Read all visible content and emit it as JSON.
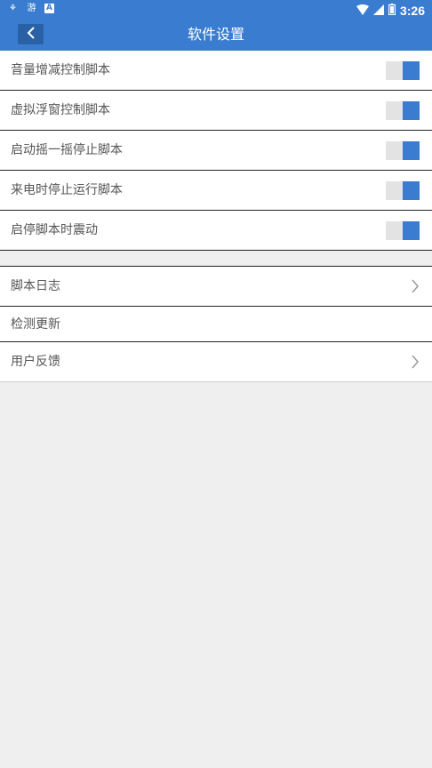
{
  "status_bar": {
    "left_icons": [
      "app-notification-icon",
      "game-notification-icon",
      "a-notification-icon"
    ],
    "left_texts": [
      "⚘",
      "游",
      "A"
    ],
    "time": "3:26",
    "right_icons": [
      "wifi-icon",
      "cell-signal-icon",
      "battery-icon"
    ]
  },
  "app_bar": {
    "title": "软件设置",
    "back_icon": "chevron-left-icon"
  },
  "settings": {
    "toggles": [
      {
        "label": "音量增减控制脚本",
        "on": true
      },
      {
        "label": "虚拟浮窗控制脚本",
        "on": true
      },
      {
        "label": "启动摇一摇停止脚本",
        "on": true
      },
      {
        "label": "来电时停止运行脚本",
        "on": true
      },
      {
        "label": "启停脚本时震动",
        "on": true
      }
    ],
    "links": [
      {
        "label": "脚本日志",
        "chevron": true
      },
      {
        "label": "检测更新",
        "chevron": false
      },
      {
        "label": "用户反馈",
        "chevron": true
      }
    ]
  },
  "colors": {
    "accent": "#3a7dd0",
    "toggle_track": "#e3e3e3",
    "background": "#efefef"
  }
}
